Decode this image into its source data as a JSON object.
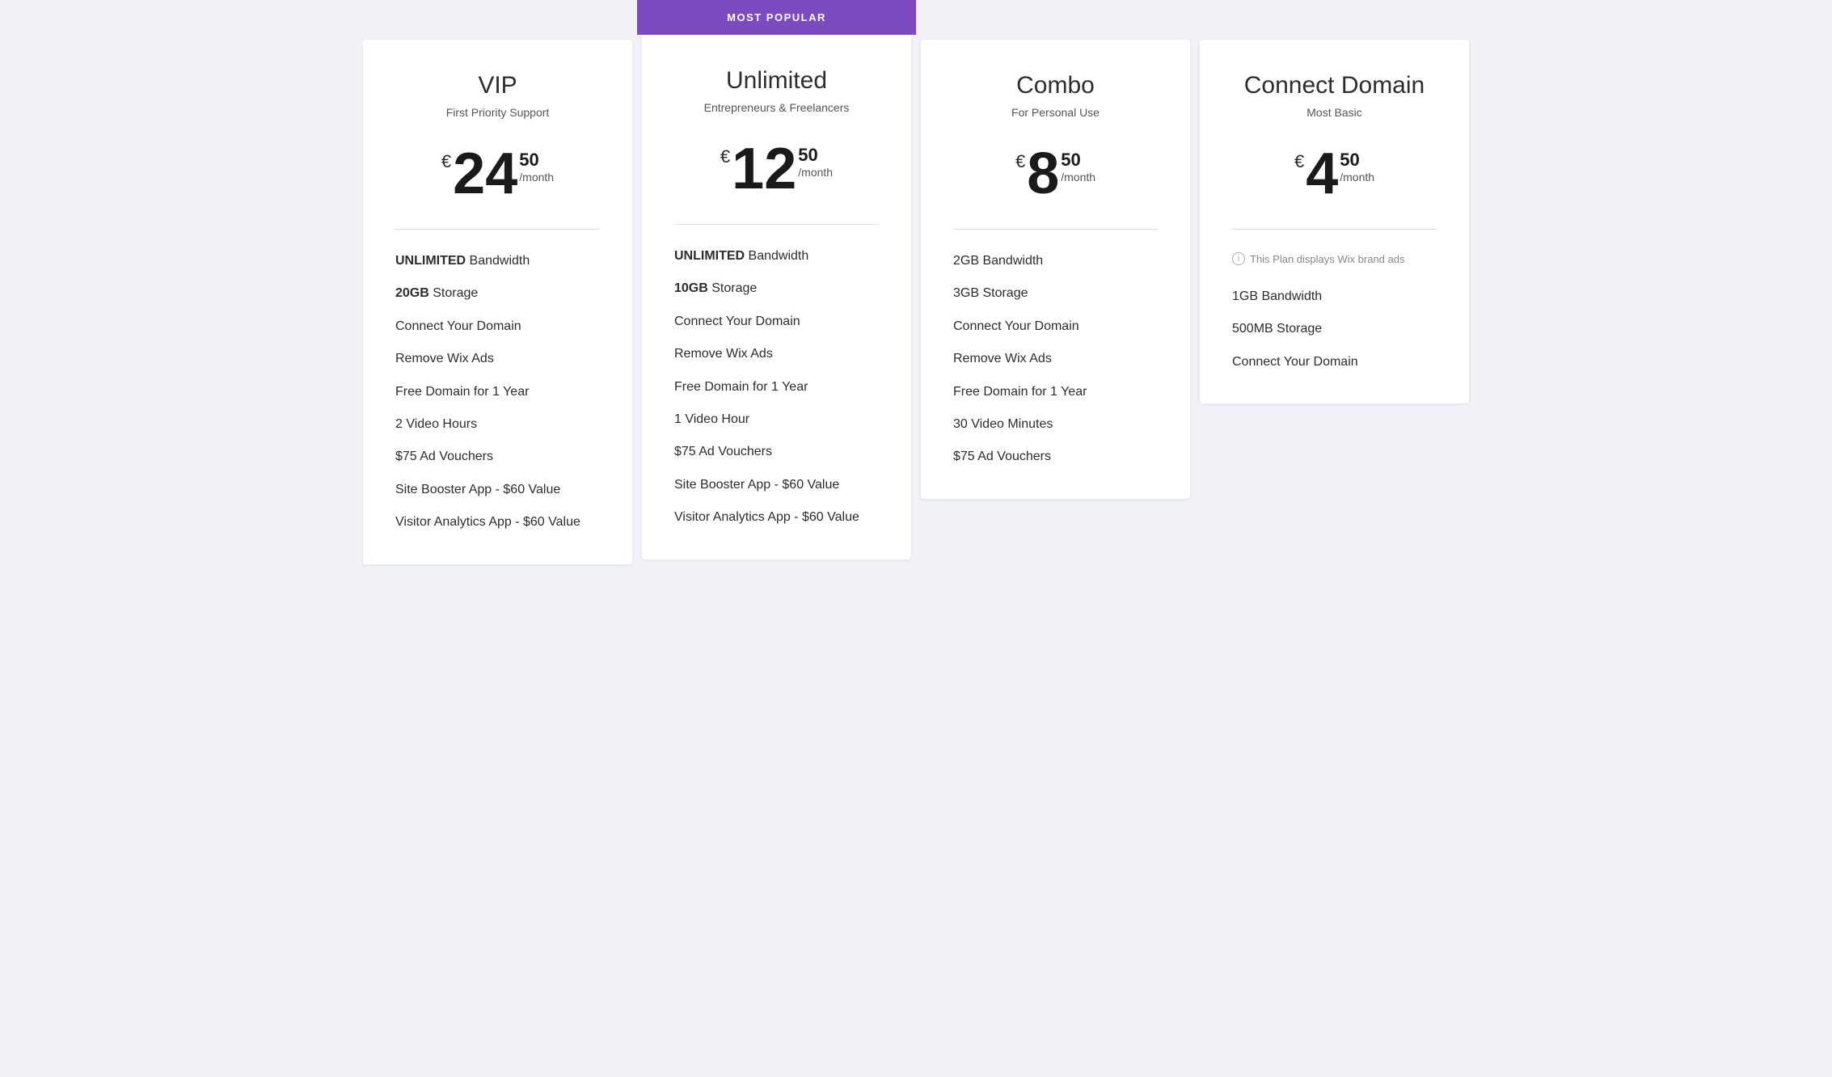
{
  "plans": [
    {
      "id": "vip",
      "name": "VIP",
      "subtitle": "First Priority Support",
      "currency": "€",
      "price_main": "24",
      "price_cents": "50",
      "price_period": "/month",
      "popular": false,
      "wix_ads": false,
      "features": [
        {
          "bold": "UNLIMITED",
          "rest": " Bandwidth"
        },
        {
          "bold": "20GB",
          "rest": " Storage"
        },
        {
          "bold": "",
          "rest": "Connect Your Domain"
        },
        {
          "bold": "",
          "rest": "Remove Wix Ads"
        },
        {
          "bold": "",
          "rest": "Free Domain for 1 Year"
        },
        {
          "bold": "",
          "rest": "2 Video Hours"
        },
        {
          "bold": "",
          "rest": "$75 Ad Vouchers"
        },
        {
          "bold": "",
          "rest": "Site Booster App - $60 Value"
        },
        {
          "bold": "",
          "rest": "Visitor Analytics App - $60 Value"
        }
      ]
    },
    {
      "id": "unlimited",
      "name": "Unlimited",
      "subtitle": "Entrepreneurs & Freelancers",
      "currency": "€",
      "price_main": "12",
      "price_cents": "50",
      "price_period": "/month",
      "popular": true,
      "popular_label": "MOST POPULAR",
      "wix_ads": false,
      "features": [
        {
          "bold": "UNLIMITED",
          "rest": " Bandwidth"
        },
        {
          "bold": "10GB",
          "rest": " Storage"
        },
        {
          "bold": "",
          "rest": "Connect Your Domain"
        },
        {
          "bold": "",
          "rest": "Remove Wix Ads"
        },
        {
          "bold": "",
          "rest": "Free Domain for 1 Year"
        },
        {
          "bold": "",
          "rest": "1 Video Hour"
        },
        {
          "bold": "",
          "rest": "$75 Ad Vouchers"
        },
        {
          "bold": "",
          "rest": "Site Booster App - $60 Value"
        },
        {
          "bold": "",
          "rest": "Visitor Analytics App - $60 Value"
        }
      ]
    },
    {
      "id": "combo",
      "name": "Combo",
      "subtitle": "For Personal Use",
      "currency": "€",
      "price_main": "8",
      "price_cents": "50",
      "price_period": "/month",
      "popular": false,
      "wix_ads": false,
      "features": [
        {
          "bold": "",
          "rest": "2GB Bandwidth"
        },
        {
          "bold": "",
          "rest": "3GB Storage"
        },
        {
          "bold": "",
          "rest": "Connect Your Domain"
        },
        {
          "bold": "",
          "rest": "Remove Wix Ads"
        },
        {
          "bold": "",
          "rest": "Free Domain for 1 Year"
        },
        {
          "bold": "",
          "rest": "30 Video Minutes"
        },
        {
          "bold": "",
          "rest": "$75 Ad Vouchers"
        }
      ]
    },
    {
      "id": "connect-domain",
      "name": "Connect Domain",
      "subtitle": "Most Basic",
      "currency": "€",
      "price_main": "4",
      "price_cents": "50",
      "price_period": "/month",
      "popular": false,
      "wix_ads": true,
      "wix_ads_text": "This Plan displays Wix brand ads",
      "features": [
        {
          "bold": "",
          "rest": "1GB Bandwidth"
        },
        {
          "bold": "",
          "rest": "500MB Storage"
        },
        {
          "bold": "",
          "rest": "Connect Your Domain"
        }
      ]
    }
  ]
}
